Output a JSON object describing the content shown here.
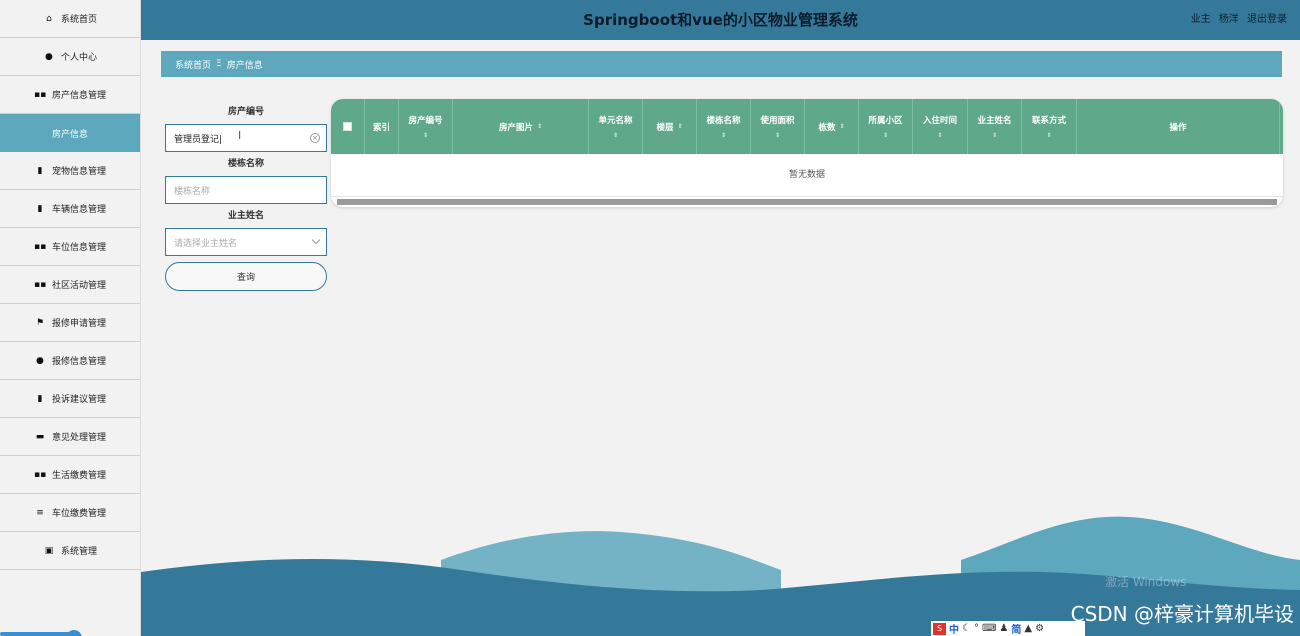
{
  "header": {
    "title": "Springboot和vue的小区物业管理系统",
    "user_role": "业主",
    "user_name": "杨洋",
    "logout_label": "退出登录"
  },
  "sidebar": {
    "items": [
      {
        "label": "系统首页",
        "icon": "home-icon",
        "glyph": "⌂"
      },
      {
        "label": "个人中心",
        "icon": "user-icon",
        "glyph": "●"
      },
      {
        "label": "房产信息管理",
        "icon": "grid-icon",
        "glyph": "▪▪"
      },
      {
        "label": "房产信息",
        "icon": "",
        "glyph": "",
        "active": true
      },
      {
        "label": "宠物信息管理",
        "icon": "clipboard-icon",
        "glyph": "▮"
      },
      {
        "label": "车辆信息管理",
        "icon": "clipboard-check-icon",
        "glyph": "▮"
      },
      {
        "label": "车位信息管理",
        "icon": "grid-icon",
        "glyph": "▪▪"
      },
      {
        "label": "社区活动管理",
        "icon": "grid-icon",
        "glyph": "▪▪"
      },
      {
        "label": "报修申请管理",
        "icon": "flag-icon",
        "glyph": "⚑"
      },
      {
        "label": "报修信息管理",
        "icon": "bulb-icon",
        "glyph": "●"
      },
      {
        "label": "投诉建议管理",
        "icon": "bar-chart-icon",
        "glyph": "▮"
      },
      {
        "label": "意见处理管理",
        "icon": "printer-icon",
        "glyph": "▬"
      },
      {
        "label": "生活缴费管理",
        "icon": "grid-icon",
        "glyph": "▪▪"
      },
      {
        "label": "车位缴费管理",
        "icon": "sliders-icon",
        "glyph": "≡"
      },
      {
        "label": "系统管理",
        "icon": "chart-box-icon",
        "glyph": "▣"
      }
    ]
  },
  "breadcrumb": {
    "home": "系统首页",
    "separator": "Ξ",
    "current": "房产信息"
  },
  "search": {
    "field1_label": "房产编号",
    "field1_value": "管理员登记|",
    "field2_label": "楼栋名称",
    "field2_placeholder": "楼栋名称",
    "field3_label": "业主姓名",
    "field3_placeholder": "请选择业主姓名",
    "query_label": "查询"
  },
  "table": {
    "columns": [
      {
        "label": "",
        "kind": "checkbox"
      },
      {
        "label": "索引",
        "kind": "plain"
      },
      {
        "label": "房产编号",
        "kind": "stack"
      },
      {
        "label": "房产图片",
        "kind": "inline"
      },
      {
        "label": "单元名称",
        "kind": "stack"
      },
      {
        "label": "楼层",
        "kind": "inline"
      },
      {
        "label": "楼栋名称",
        "kind": "stack"
      },
      {
        "label": "使用面积",
        "kind": "stack"
      },
      {
        "label": "栋数",
        "kind": "inline"
      },
      {
        "label": "所属小区",
        "kind": "stack"
      },
      {
        "label": "入住时间",
        "kind": "stack"
      },
      {
        "label": "业主姓名",
        "kind": "stack"
      },
      {
        "label": "联系方式",
        "kind": "stack"
      },
      {
        "label": "操作",
        "kind": "plain"
      }
    ],
    "empty_text": "暂无数据"
  },
  "watermark": {
    "activate": "激活 Windows",
    "credit": "CSDN @梓豪计算机毕设"
  },
  "tray": {
    "items": [
      "中",
      "简"
    ]
  },
  "colors": {
    "header_bg": "#35799a",
    "breadcrumb_bg": "#5ea8bd",
    "table_header_bg": "#5fa88a",
    "wave_dark": "#35799a",
    "wave_light": "#5ea8bd"
  }
}
